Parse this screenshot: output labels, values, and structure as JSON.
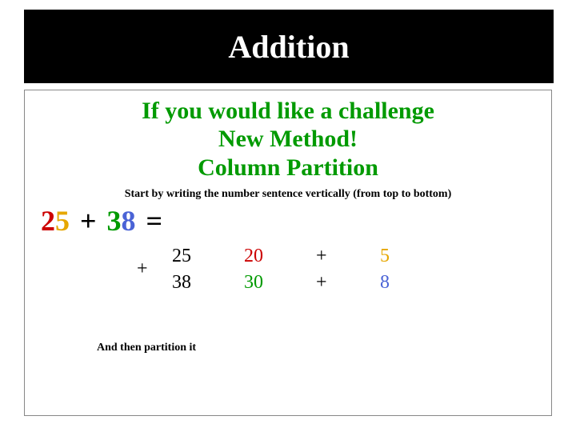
{
  "title": "Addition",
  "challenge_l1": "If you would like a challenge",
  "challenge_l2": "New Method!",
  "challenge_l3": "Column Partition",
  "start_text": "Start by writing the number sentence vertically (from top to bottom)",
  "sentence": {
    "a1": "2",
    "a2": "5",
    "plus": "+",
    "b1": "3",
    "b2": "8",
    "eq": "="
  },
  "plus": "+",
  "row1": {
    "num": "25",
    "tens": "20",
    "plus": "+",
    "ones": "5"
  },
  "row2": {
    "num": "38",
    "tens": "30",
    "plus": "+",
    "ones": "8"
  },
  "then_text": "And then partition it"
}
